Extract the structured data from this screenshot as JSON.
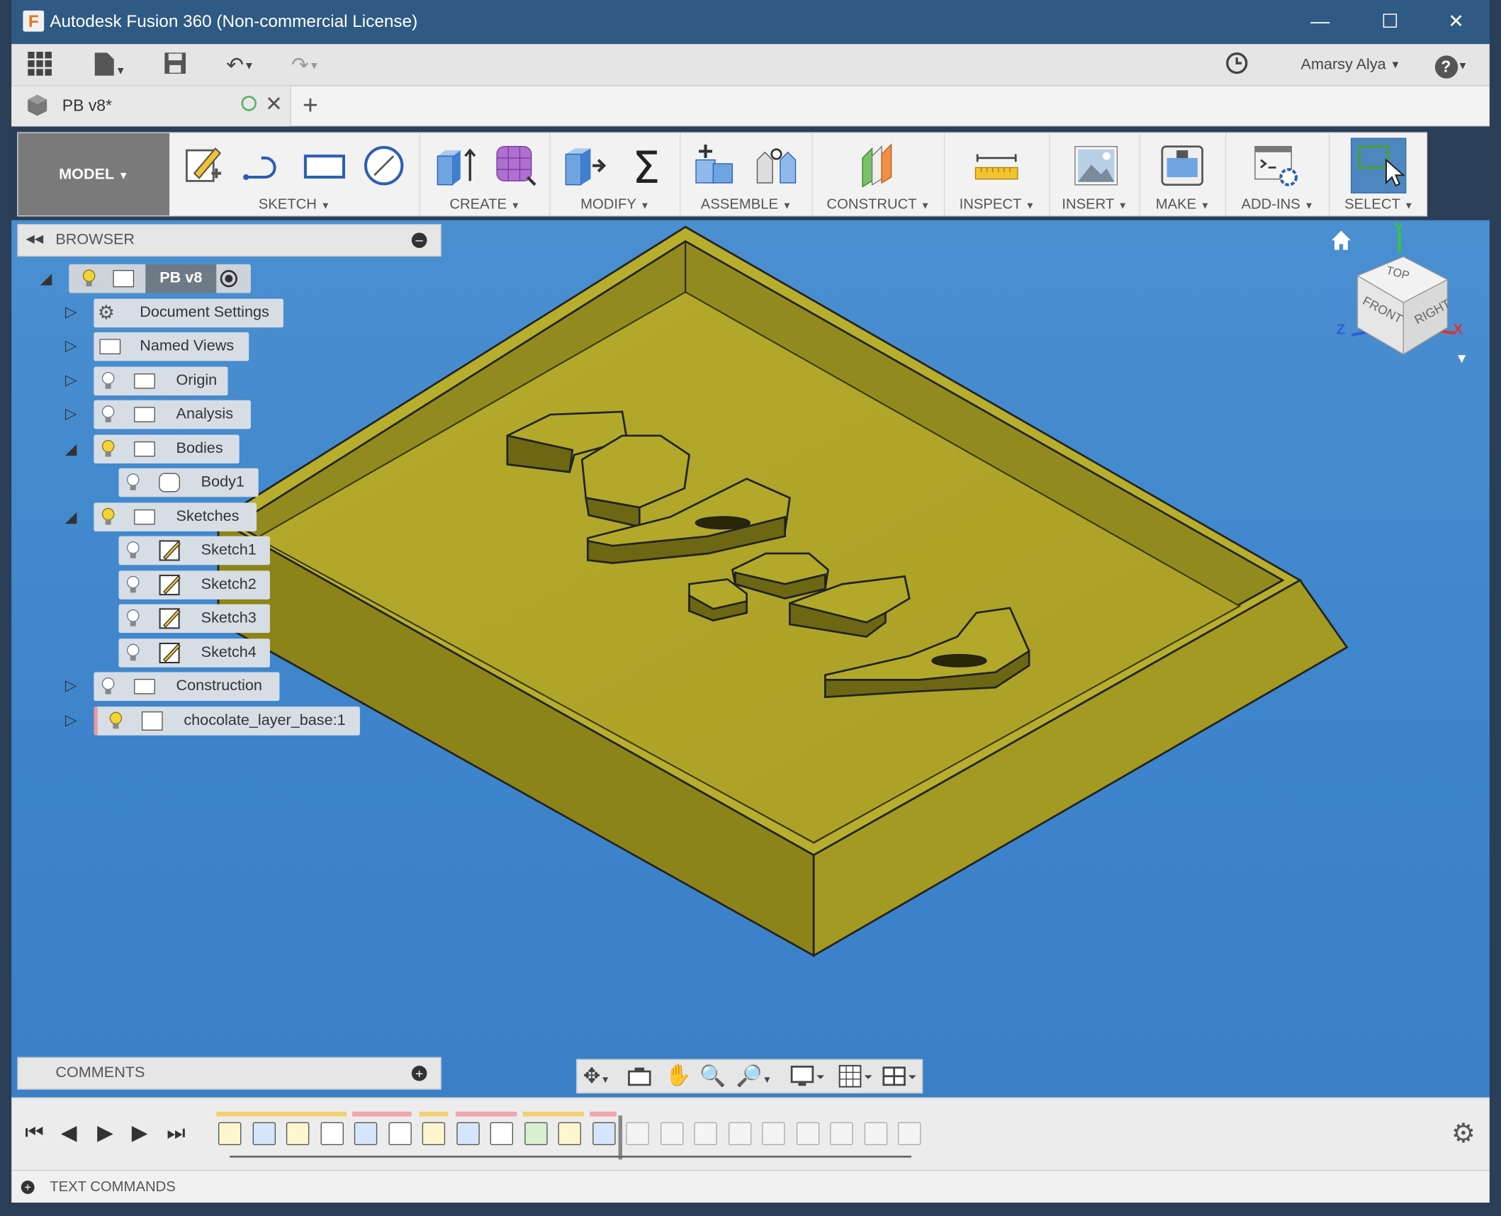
{
  "window": {
    "title": "Autodesk Fusion 360 (Non-commercial License)",
    "app_letter": "F"
  },
  "qat": {
    "user": "Amarsy Alya",
    "help": "?"
  },
  "doc_tab": {
    "name": "PB v8*",
    "new_tab": "+"
  },
  "ribbon": {
    "workspace": "MODEL",
    "groups": [
      {
        "label": "SKETCH"
      },
      {
        "label": "CREATE"
      },
      {
        "label": "MODIFY"
      },
      {
        "label": "ASSEMBLE"
      },
      {
        "label": "CONSTRUCT"
      },
      {
        "label": "INSPECT"
      },
      {
        "label": "INSERT"
      },
      {
        "label": "MAKE"
      },
      {
        "label": "ADD-INS"
      },
      {
        "label": "SELECT"
      }
    ]
  },
  "browser": {
    "title": "BROWSER",
    "root": "PB v8",
    "items": [
      {
        "label": "Document Settings"
      },
      {
        "label": "Named Views"
      },
      {
        "label": "Origin"
      },
      {
        "label": "Analysis"
      },
      {
        "label": "Bodies"
      },
      {
        "label": "Body1"
      },
      {
        "label": "Sketches"
      },
      {
        "label": "Sketch1"
      },
      {
        "label": "Sketch2"
      },
      {
        "label": "Sketch3"
      },
      {
        "label": "Sketch4"
      },
      {
        "label": "Construction"
      },
      {
        "label": "chocolate_layer_base:1"
      }
    ]
  },
  "viewcube": {
    "top": "TOP",
    "front": "FRONT",
    "right": "RIGHT",
    "x": "X",
    "y": "Y",
    "z": "Z"
  },
  "comments": {
    "title": "COMMENTS"
  },
  "text_commands": {
    "label": "TEXT COMMANDS"
  },
  "colors": {
    "viewport": "#3d84cc",
    "model": "#b5ac2a",
    "accent": "#e8731e"
  }
}
